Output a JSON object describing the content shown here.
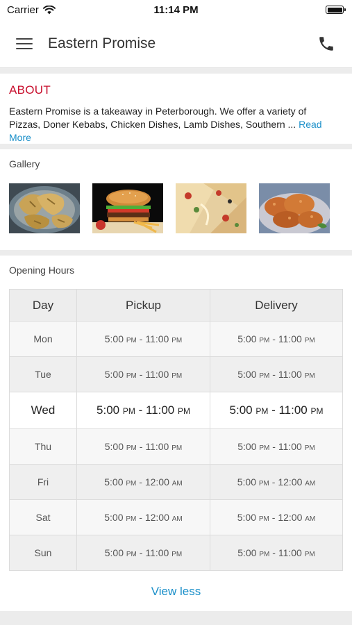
{
  "status_bar": {
    "carrier": "Carrier",
    "time": "11:14 PM",
    "icons": [
      "wifi-icon",
      "battery-icon"
    ]
  },
  "header": {
    "title": "Eastern Promise",
    "menu_icon": "hamburger-menu-icon",
    "call_icon": "phone-icon"
  },
  "about": {
    "heading": "ABOUT",
    "text_line1": "Eastern Promise is a takeaway in Peterborough. We offer a variety of",
    "text_line2": "Pizzas, Doner Kebabs, Chicken Dishes, Lamb Dishes, Southern ...",
    "read_more": "Read More"
  },
  "gallery": {
    "label": "Gallery",
    "images": [
      "flatbread-dish-photo",
      "burger-and-fries-photo",
      "pizza-slices-photo",
      "fried-chicken-photo"
    ]
  },
  "opening_hours": {
    "label": "Opening Hours",
    "columns": [
      "Day",
      "Pickup",
      "Delivery"
    ],
    "rows": [
      {
        "day": "Mon",
        "pickup_open": "5:00",
        "pickup_open_ampm": "PM",
        "pickup_close": "11:00",
        "pickup_close_ampm": "PM",
        "delivery_open": "5:00",
        "delivery_open_ampm": "PM",
        "delivery_close": "11:00",
        "delivery_close_ampm": "PM"
      },
      {
        "day": "Tue",
        "pickup_open": "5:00",
        "pickup_open_ampm": "PM",
        "pickup_close": "11:00",
        "pickup_close_ampm": "PM",
        "delivery_open": "5:00",
        "delivery_open_ampm": "PM",
        "delivery_close": "11:00",
        "delivery_close_ampm": "PM"
      },
      {
        "day": "Wed",
        "pickup_open": "5:00",
        "pickup_open_ampm": "PM",
        "pickup_close": "11:00",
        "pickup_close_ampm": "PM",
        "delivery_open": "5:00",
        "delivery_open_ampm": "PM",
        "delivery_close": "11:00",
        "delivery_close_ampm": "PM"
      },
      {
        "day": "Thu",
        "pickup_open": "5:00",
        "pickup_open_ampm": "PM",
        "pickup_close": "11:00",
        "pickup_close_ampm": "PM",
        "delivery_open": "5:00",
        "delivery_open_ampm": "PM",
        "delivery_close": "11:00",
        "delivery_close_ampm": "PM"
      },
      {
        "day": "Fri",
        "pickup_open": "5:00",
        "pickup_open_ampm": "PM",
        "pickup_close": "12:00",
        "pickup_close_ampm": "AM",
        "delivery_open": "5:00",
        "delivery_open_ampm": "PM",
        "delivery_close": "12:00",
        "delivery_close_ampm": "AM"
      },
      {
        "day": "Sat",
        "pickup_open": "5:00",
        "pickup_open_ampm": "PM",
        "pickup_close": "12:00",
        "pickup_close_ampm": "AM",
        "delivery_open": "5:00",
        "delivery_open_ampm": "PM",
        "delivery_close": "12:00",
        "delivery_close_ampm": "AM"
      },
      {
        "day": "Sun",
        "pickup_open": "5:00",
        "pickup_open_ampm": "PM",
        "pickup_close": "11:00",
        "pickup_close_ampm": "PM",
        "delivery_open": "5:00",
        "delivery_open_ampm": "PM",
        "delivery_close": "11:00",
        "delivery_close_ampm": "PM"
      }
    ],
    "view_less": "View less"
  },
  "colors": {
    "accent_red": "#c8102e",
    "link_blue": "#1a8fc9"
  }
}
